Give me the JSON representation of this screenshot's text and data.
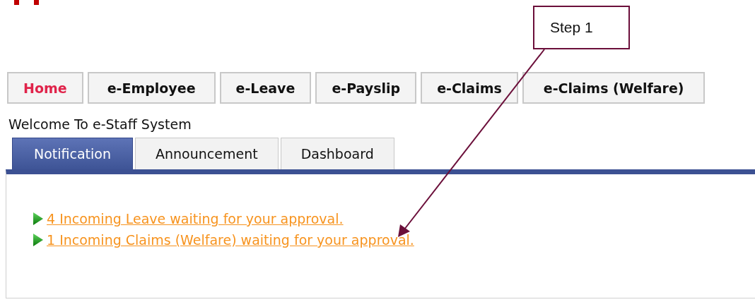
{
  "menu": [
    {
      "label": "Home",
      "selected": true
    },
    {
      "label": "e-Employee",
      "selected": false
    },
    {
      "label": "e-Leave",
      "selected": false
    },
    {
      "label": "e-Payslip",
      "selected": false
    },
    {
      "label": "e-Claims",
      "selected": false
    },
    {
      "label": "e-Claims (Welfare)",
      "selected": false
    }
  ],
  "welcome": "Welcome To e-Staff System",
  "tabs": [
    {
      "label": "Notification",
      "selected": true
    },
    {
      "label": "Announcement",
      "selected": false
    },
    {
      "label": "Dashboard",
      "selected": false
    }
  ],
  "notifications": [
    "4 Incoming Leave waiting for your approval.",
    "1 Incoming Claims (Welfare) waiting for your approval."
  ],
  "callout": {
    "text": "Step 1"
  }
}
